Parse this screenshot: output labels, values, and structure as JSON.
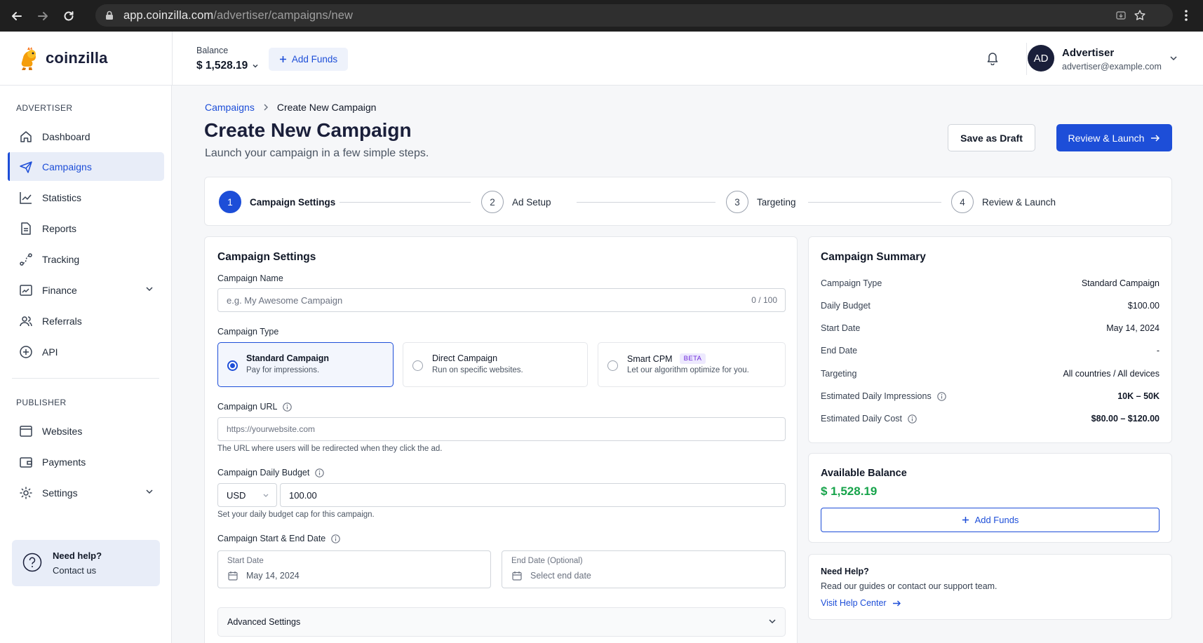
{
  "browser": {
    "url_host": "app.coinzilla.com",
    "url_path": "/advertiser/campaigns/new"
  },
  "header": {
    "logo_text": "coinzilla",
    "balance_label": "Balance",
    "balance_value": "$ 1,528.19",
    "add_funds_label": "Add Funds",
    "user_initials": "AD",
    "user_name": "Advertiser",
    "user_email": "advertiser@example.com"
  },
  "sidebar": {
    "advertiser_heading": "ADVERTISER",
    "advertiser_items": [
      {
        "label": "Dashboard",
        "icon": "home-icon"
      },
      {
        "label": "Campaigns",
        "icon": "send-icon",
        "active": true
      },
      {
        "label": "Statistics",
        "icon": "chart-line-icon"
      },
      {
        "label": "Reports",
        "icon": "document-icon"
      },
      {
        "label": "Tracking",
        "icon": "tracking-icon"
      },
      {
        "label": "Finance",
        "icon": "finance-icon",
        "expandable": true
      },
      {
        "label": "Referrals",
        "icon": "users-icon"
      },
      {
        "label": "API",
        "icon": "api-icon"
      }
    ],
    "publisher_heading": "PUBLISHER",
    "publisher_items": [
      {
        "label": "Websites",
        "icon": "browser-icon"
      },
      {
        "label": "Payments",
        "icon": "wallet-icon"
      },
      {
        "label": "Settings",
        "icon": "gear-icon",
        "expandable": true
      }
    ],
    "help_title": "Need help?",
    "help_link": "Contact us"
  },
  "main": {
    "breadcrumb_parent": "Campaigns",
    "breadcrumb_current": "Create New Campaign",
    "title": "Create New Campaign",
    "subtitle": "Launch your campaign in a few simple steps.",
    "save_draft_label": "Save as Draft",
    "review_launch_label": "Review & Launch"
  },
  "stepper": [
    {
      "num": "1",
      "label": "Campaign Settings",
      "active": true
    },
    {
      "num": "2",
      "label": "Ad Setup"
    },
    {
      "num": "3",
      "label": "Targeting"
    },
    {
      "num": "4",
      "label": "Review & Launch"
    }
  ],
  "settings": {
    "title": "Campaign Settings",
    "name_label": "Campaign Name",
    "name_placeholder": "e.g. My Awesome Campaign",
    "name_counter": "0 / 100",
    "type_label": "Campaign Type",
    "types": [
      {
        "name": "Standard Campaign",
        "desc": "Pay for impressions.",
        "selected": true
      },
      {
        "name": "Direct Campaign",
        "desc": "Run on specific websites."
      },
      {
        "name": "Smart CPM",
        "desc": "Let our algorithm optimize for you.",
        "badge": "BETA"
      }
    ],
    "url_label": "Campaign URL",
    "url_placeholder": "https://yourwebsite.com",
    "url_help": "The URL where users will be redirected when they click the ad.",
    "budget_label": "Campaign Daily Budget",
    "currency": "USD",
    "budget_value": "100.00",
    "budget_help": "Set your daily budget cap for this campaign.",
    "dates_label": "Campaign Start & End Date",
    "start_label": "Start Date",
    "start_value": "May 14, 2024",
    "end_label": "End Date (Optional)",
    "end_placeholder": "Select end date",
    "advanced_label": "Advanced Settings"
  },
  "summary": {
    "title": "Campaign Summary",
    "rows": [
      {
        "key": "Campaign Type",
        "value": "Standard Campaign"
      },
      {
        "key": "Daily Budget",
        "value": "$100.00"
      },
      {
        "key": "Start Date",
        "value": "May 14, 2024"
      },
      {
        "key": "End Date",
        "value": "-"
      },
      {
        "key": "Targeting",
        "value": "All countries / All devices"
      },
      {
        "key": "Estimated Daily Impressions",
        "value": "10K – 50K",
        "info": true,
        "bold": true
      },
      {
        "key": "Estimated Daily Cost",
        "value": "$80.00 – $120.00",
        "info": true,
        "bold": true
      }
    ]
  },
  "balance_card": {
    "title": "Available Balance",
    "value": "$ 1,528.19",
    "add_funds_label": "Add Funds"
  },
  "need_help": {
    "title": "Need Help?",
    "text": "Read our guides or contact our support team.",
    "link": "Visit Help Center"
  },
  "colors": {
    "accent": "#1d4ed8",
    "brand_dark": "#1a1f3a",
    "balance_green": "#16a34a"
  }
}
